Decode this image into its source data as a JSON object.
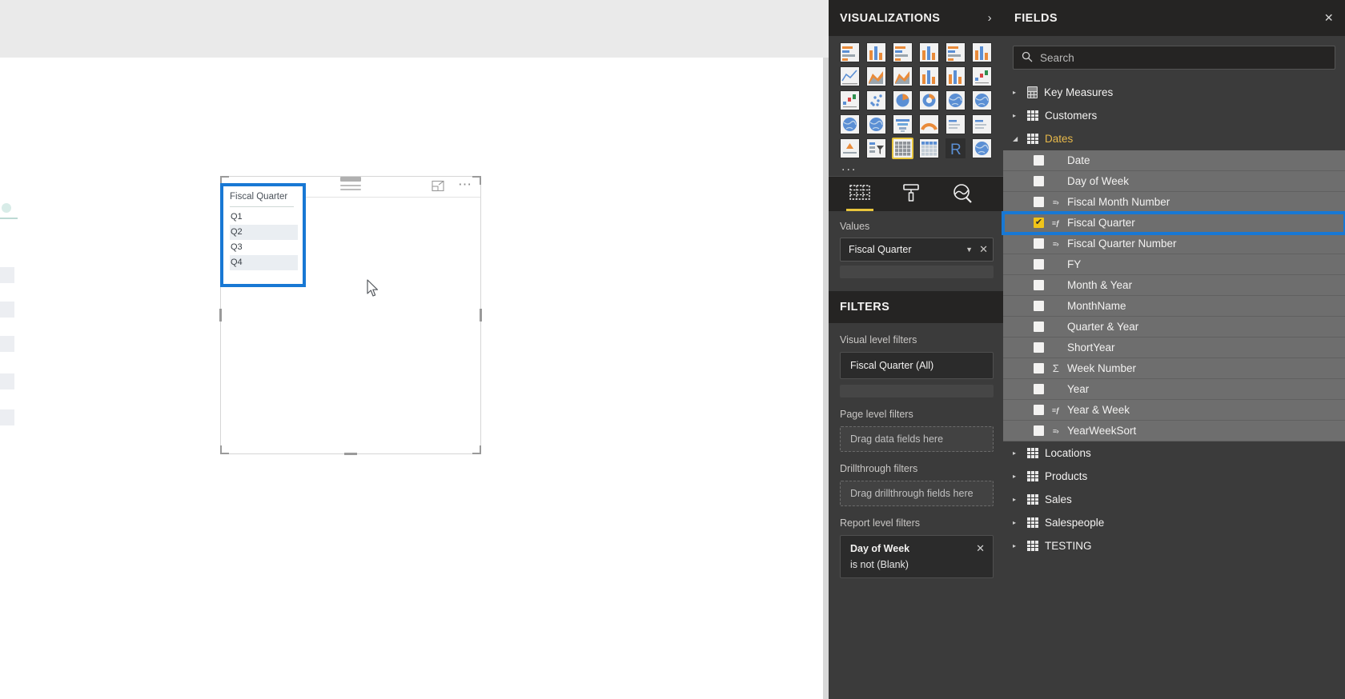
{
  "canvas": {
    "visual": {
      "title": "Fiscal Quarter",
      "rows": [
        "Q1",
        "Q2",
        "Q3",
        "Q4"
      ],
      "focus_icon": "focus-mode-icon",
      "more_icon": "more-options-icon",
      "drag_icon": "drag-handle-icon",
      "selection_color": "#1878d4"
    }
  },
  "visualizations": {
    "title": "VISUALIZATIONS",
    "expand_icon": "chevron-right-icon",
    "more_label": "...",
    "icons": [
      "stacked-bar-chart-icon",
      "stacked-column-chart-icon",
      "clustered-bar-chart-icon",
      "clustered-column-chart-icon",
      "hundred-percent-stacked-bar-icon",
      "hundred-percent-stacked-column-icon",
      "line-chart-icon",
      "area-chart-icon",
      "stacked-area-chart-icon",
      "line-and-stacked-column-icon",
      "line-and-clustered-column-icon",
      "ribbon-chart-icon",
      "waterfall-chart-icon",
      "scatter-chart-icon",
      "pie-chart-icon",
      "donut-chart-icon",
      "treemap-icon",
      "map-icon",
      "filled-map-icon",
      "shape-map-icon",
      "funnel-chart-icon",
      "gauge-chart-icon",
      "card-icon",
      "multi-row-card-icon",
      "kpi-icon",
      "slicer-icon",
      "table-icon",
      "matrix-icon",
      "r-script-visual-icon",
      "globe-map-icon"
    ],
    "selected_icon_index": 26,
    "selected_icon_outline": "#e8c53c",
    "tabs": [
      {
        "name": "fields-tab",
        "active": true
      },
      {
        "name": "format-tab",
        "active": false
      },
      {
        "name": "analytics-tab",
        "active": false
      }
    ],
    "wells": {
      "values_label": "Values",
      "values_chip": "Fiscal Quarter",
      "chip_caret_icon": "chevron-down-icon",
      "chip_remove_icon": "close-icon"
    }
  },
  "filters": {
    "title": "FILTERS",
    "visual_level_label": "Visual level filters",
    "visual_level_items": [
      {
        "label": "Fiscal Quarter  (All)"
      }
    ],
    "page_level_label": "Page level filters",
    "page_level_placeholder": "Drag data fields here",
    "drillthrough_label": "Drillthrough filters",
    "drillthrough_placeholder": "Drag drillthrough fields here",
    "report_level_label": "Report level filters",
    "report_level_items": [
      {
        "label": "Day of Week",
        "condition": "is not (Blank)",
        "remove_icon": "close-icon"
      }
    ]
  },
  "fields": {
    "title": "FIELDS",
    "close_icon": "close-icon",
    "search": {
      "placeholder": "Search",
      "icon": "search-icon",
      "value": ""
    },
    "tables": [
      {
        "name": "Key Measures",
        "expanded": false,
        "icon": "calculator-icon",
        "tri": "▸"
      },
      {
        "name": "Customers",
        "expanded": false,
        "icon": "table-icon",
        "tri": "▸"
      },
      {
        "name": "Dates",
        "expanded": true,
        "icon": "table-icon",
        "tri": "◢"
      },
      {
        "name": "Locations",
        "expanded": false,
        "icon": "table-icon",
        "tri": "▸"
      },
      {
        "name": "Products",
        "expanded": false,
        "icon": "table-icon",
        "tri": "▸"
      },
      {
        "name": "Sales",
        "expanded": false,
        "icon": "table-icon",
        "tri": "▸"
      },
      {
        "name": "Salespeople",
        "expanded": false,
        "icon": "table-icon",
        "tri": "▸"
      },
      {
        "name": "TESTING",
        "expanded": false,
        "icon": "table-icon",
        "tri": "▸"
      }
    ],
    "dates_fields": [
      {
        "label": "Date",
        "checked": false,
        "marker": ""
      },
      {
        "label": "Day of Week",
        "checked": false,
        "marker": ""
      },
      {
        "label": "Fiscal Month Number",
        "checked": false,
        "marker": "sort"
      },
      {
        "label": "Fiscal Quarter",
        "checked": true,
        "marker": "calc",
        "selected": true
      },
      {
        "label": "Fiscal Quarter Number",
        "checked": false,
        "marker": "sort"
      },
      {
        "label": "FY",
        "checked": false,
        "marker": ""
      },
      {
        "label": "Month & Year",
        "checked": false,
        "marker": ""
      },
      {
        "label": "MonthName",
        "checked": false,
        "marker": ""
      },
      {
        "label": "Quarter & Year",
        "checked": false,
        "marker": ""
      },
      {
        "label": "ShortYear",
        "checked": false,
        "marker": ""
      },
      {
        "label": "Week Number",
        "checked": false,
        "marker": "sigma"
      },
      {
        "label": "Year",
        "checked": false,
        "marker": ""
      },
      {
        "label": "Year & Week",
        "checked": false,
        "marker": "calc"
      },
      {
        "label": "YearWeekSort",
        "checked": false,
        "marker": "sort"
      }
    ],
    "selection_color": "#1878d4",
    "checked_color": "#f0c419"
  }
}
